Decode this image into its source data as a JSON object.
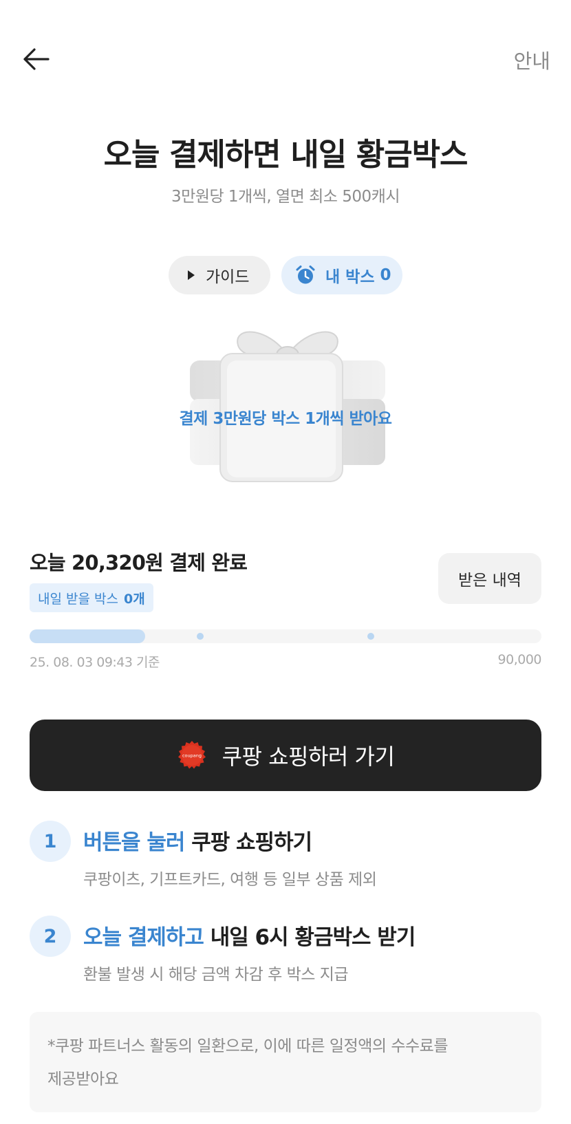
{
  "header": {
    "back_icon": "arrow-left-icon",
    "info_label": "안내"
  },
  "hero": {
    "title": "오늘 결제하면 내일 황금박스",
    "subtitle": "3만원당 1개씩, 열면 최소 500캐시"
  },
  "chips": {
    "guide_label": "가이드",
    "guide_icon": "play-icon",
    "mybox_label": "내 박스",
    "mybox_count": "0",
    "mybox_icon": "alarm-clock-icon"
  },
  "gift": {
    "icon": "gift-box-icon",
    "label": "결제 3만원당 박스 1개씩 받아요"
  },
  "payment": {
    "title": "오늘 20,320원 결제 완료",
    "badge_label": "내일 받을 박스",
    "badge_count": "0개",
    "history_label": "받은 내역"
  },
  "progress": {
    "current": 20320,
    "max": 90000,
    "milestones": [
      30000,
      60000
    ],
    "date_label": "25. 08. 03 09:43 기준",
    "max_label": "90,000"
  },
  "cta": {
    "logo_label": "coupang",
    "label": "쿠팡 쇼핑하러 가기"
  },
  "steps": [
    {
      "num": "1",
      "highlight": "버튼을 눌러",
      "rest": " 쿠팡 쇼핑하기",
      "desc": "쿠팡이츠, 기프트카드, 여행 등 일부 상품 제외"
    },
    {
      "num": "2",
      "highlight": "오늘 결제하고",
      "rest": " 내일 6시 황금박스 받기",
      "desc": "환불 발생 시 해당 금액 차감 후 박스 지급"
    }
  ],
  "notice": {
    "line1": "*쿠팡 파트너스 활동의 일환으로, 이에 따른 일정액의 수수료를",
    "line2": "제공받아요"
  },
  "colors": {
    "accent": "#3a85cf",
    "accent_bg": "#e7f1fc",
    "cta_bg": "#232323"
  }
}
